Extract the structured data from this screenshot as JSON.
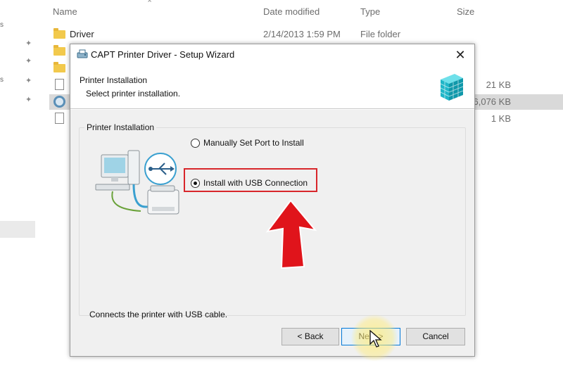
{
  "explorer": {
    "columns": {
      "name": "Name",
      "date": "Date modified",
      "type": "Type",
      "size": "Size"
    },
    "rows": [
      {
        "name": "Driver",
        "date": "2/14/2013 1:59 PM",
        "type": "File folder",
        "size": "",
        "icon": "folder-icon"
      },
      {
        "name": "",
        "date": "",
        "type": "",
        "size": "",
        "icon": "folder-icon"
      },
      {
        "name": "",
        "date": "",
        "type": "",
        "size": "",
        "icon": "folder-icon"
      },
      {
        "name": "",
        "date": "",
        "type": "",
        "size": "21 KB",
        "icon": "document-icon"
      },
      {
        "name": "",
        "date": "",
        "type": "",
        "size": "6,076 KB",
        "icon": "setup-icon"
      },
      {
        "name": "",
        "date": "",
        "type": "",
        "size": "1 KB",
        "icon": "document-icon"
      }
    ]
  },
  "dialog": {
    "title": "CAPT Printer Driver - Setup Wizard",
    "close_glyph": "✕",
    "header_title": "Printer Installation",
    "header_subtitle": "Select printer installation.",
    "group_label": "Printer Installation",
    "options": {
      "manual": {
        "label": "Manually Set Port to Install",
        "selected": false
      },
      "usb": {
        "label": "Install with USB Connection",
        "selected": true
      }
    },
    "description": "Connects the printer with USB cable.",
    "buttons": {
      "back": "< Back",
      "next": "Next >",
      "cancel": "Cancel"
    }
  },
  "colors": {
    "highlight": "#d8262b",
    "arrow": "#e0141b",
    "accent": "#0078d7"
  }
}
